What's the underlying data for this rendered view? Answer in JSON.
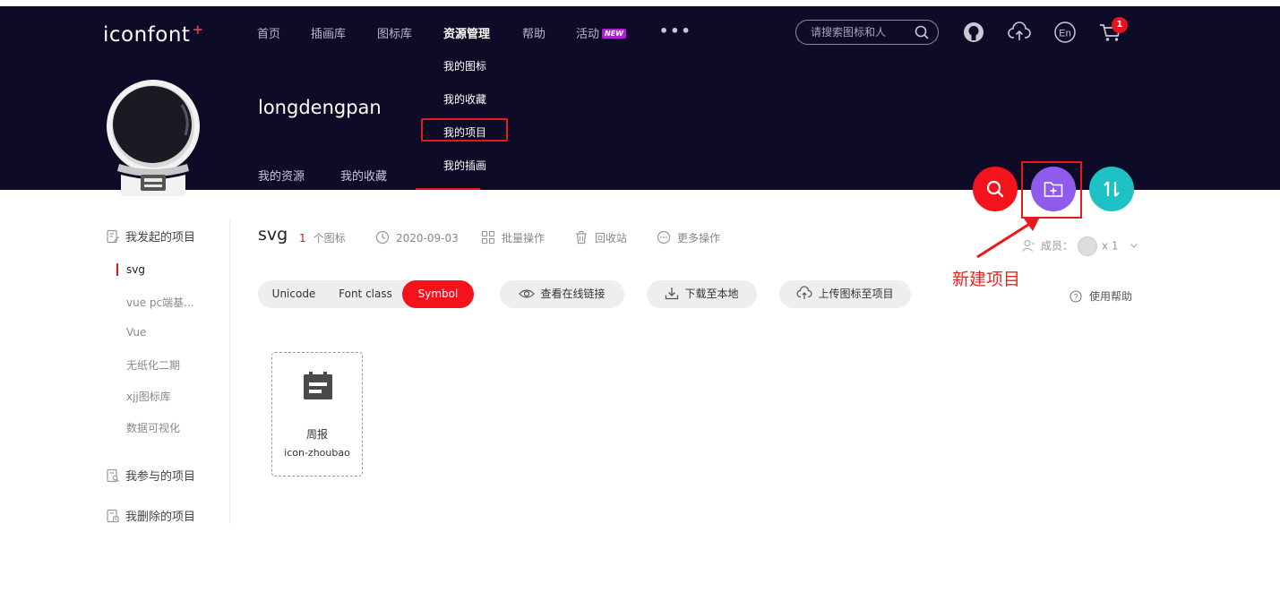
{
  "header": {
    "logo_text": "iconfont",
    "logo_plus": "+",
    "nav": [
      "首页",
      "插画库",
      "图标库",
      "资源管理",
      "帮助",
      "活动"
    ],
    "nav_badge": "NEW",
    "more": "•••",
    "search_placeholder": "请搜索图标和人",
    "cart_count": "1",
    "lang_icon_text": "En"
  },
  "dropdown": {
    "items": [
      "我的图标",
      "我的收藏",
      "我的项目",
      "我的插画"
    ]
  },
  "profile": {
    "username": "longdengpan",
    "tabs": [
      "我的资源",
      "我的收藏"
    ]
  },
  "annotation": {
    "label": "新建项目"
  },
  "sidebar": {
    "initiated_title": "我发起的项目",
    "projects": [
      "svg",
      "vue pc端基...",
      "Vue",
      "无纸化二期",
      "xjj图标库",
      "数据可视化"
    ],
    "joined_title": "我参与的项目",
    "deleted_title": "我删除的项目"
  },
  "project": {
    "title": "svg",
    "icon_count": "1",
    "icon_count_unit": "个图标",
    "date": "2020-09-03",
    "batch": "批量操作",
    "recycle": "回收站",
    "more": "更多操作",
    "members_label": "成员：",
    "members_count": "x 1"
  },
  "toolbar": {
    "formats": [
      "Unicode",
      "Font class",
      "Symbol"
    ],
    "active_format": "Symbol",
    "view_online": "查看在线链接",
    "download": "下载至本地",
    "upload": "上传图标至项目",
    "help": "使用帮助"
  },
  "icons": [
    {
      "name": "周报",
      "code": "icon-zhoubao"
    }
  ],
  "colors": {
    "header_bg": "#0d0b26",
    "accent_red": "#f4131c",
    "new_project_purple": "#8e5bea",
    "sort_teal": "#1fc2c4",
    "annotation_red": "#e51b1b"
  }
}
